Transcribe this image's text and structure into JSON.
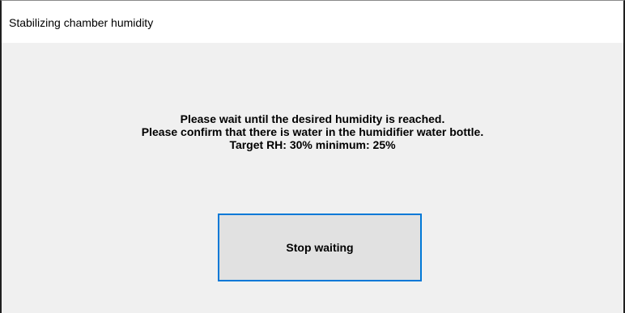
{
  "window": {
    "title": "Stabilizing chamber humidity"
  },
  "message": {
    "line1": "Please wait until the desired humidity is reached.",
    "line2": "Please confirm that there is water in the humidifier water bottle.",
    "line3": "Target RH: 30% minimum: 25%"
  },
  "actions": {
    "stop_label": "Stop waiting"
  },
  "colors": {
    "accent": "#0078d7",
    "dialog_bg": "#f0f0f0",
    "button_bg": "#e1e1e1"
  }
}
